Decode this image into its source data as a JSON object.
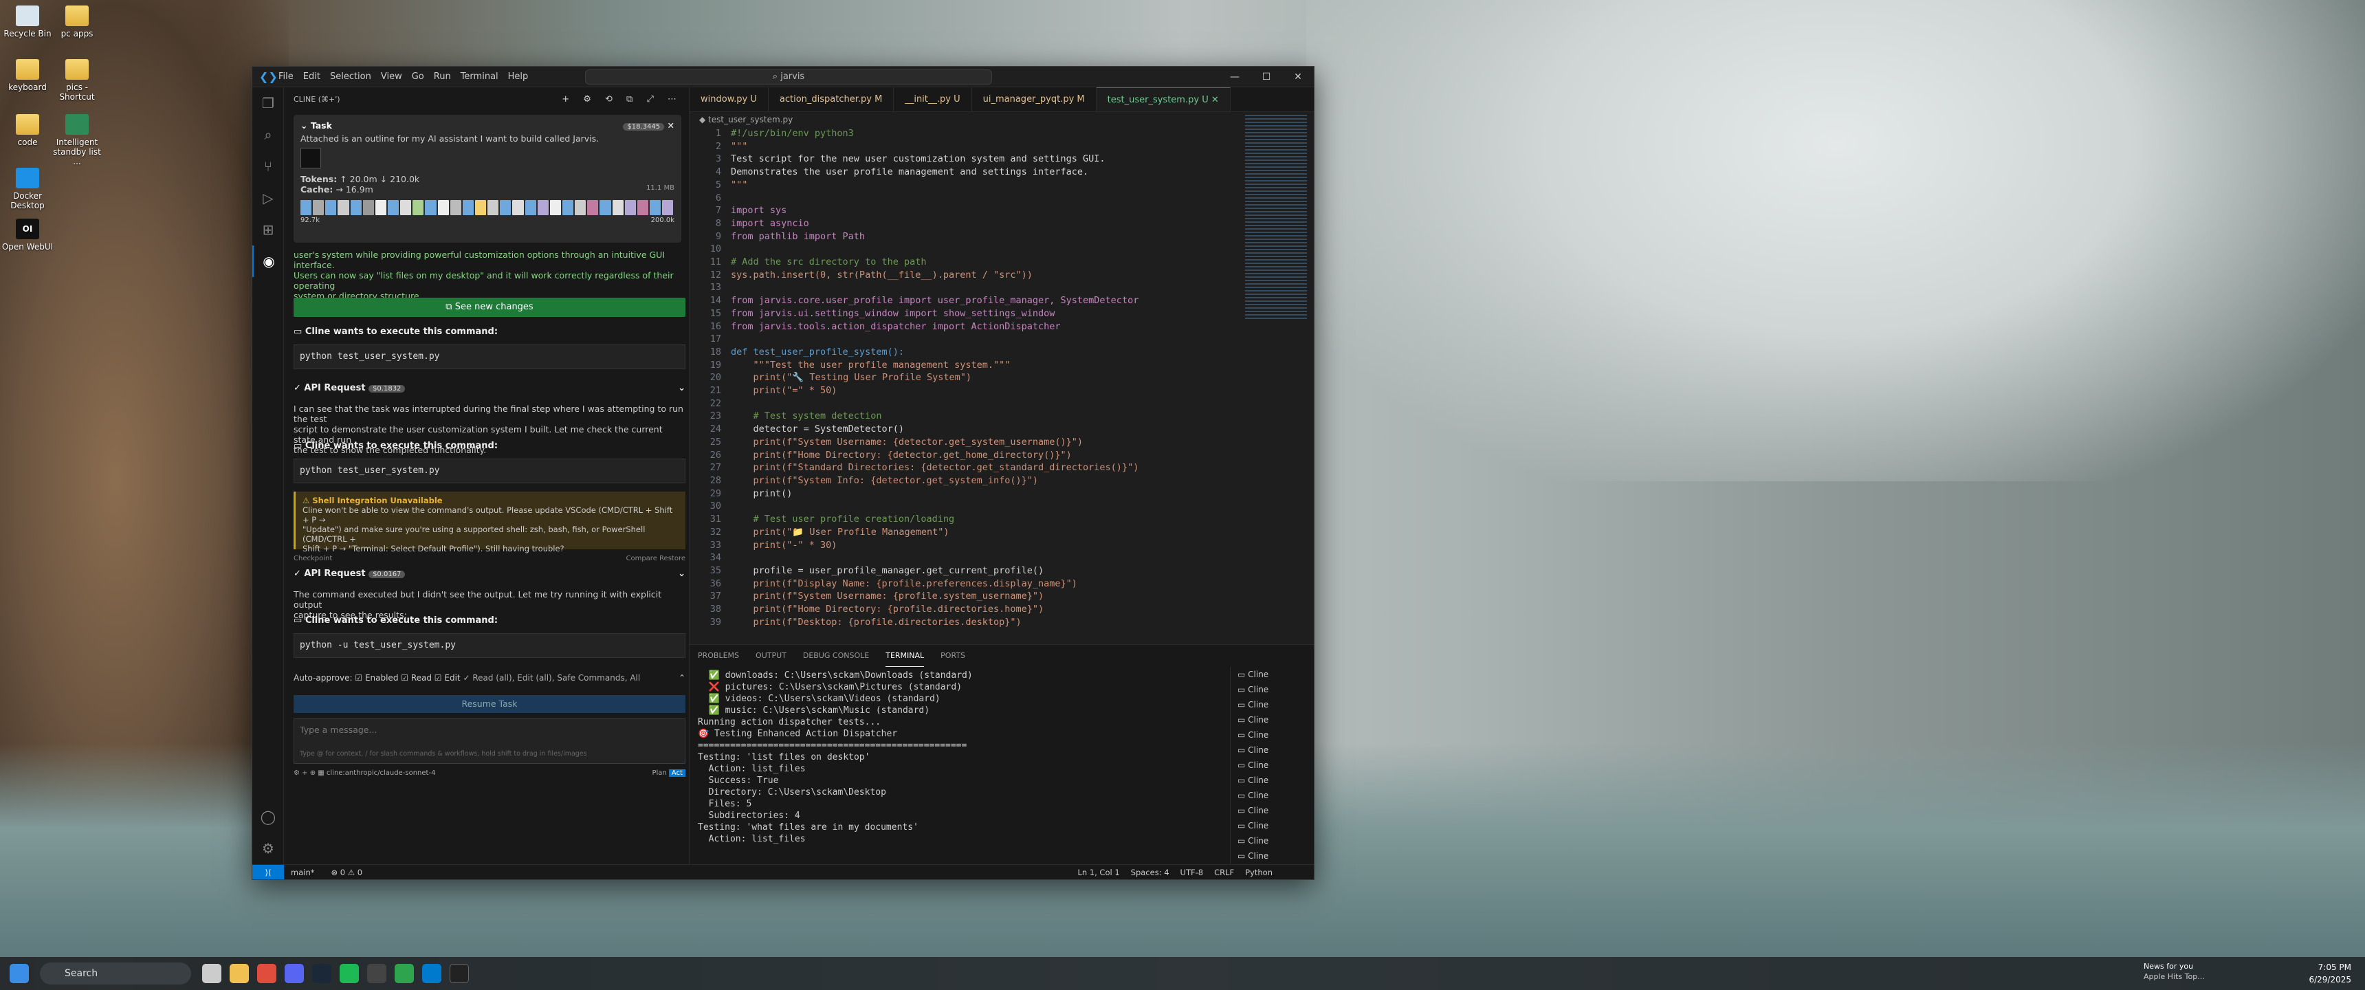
{
  "desktop": {
    "icons": [
      {
        "label": "Recycle Bin",
        "icon": "recycle-bin-icon"
      },
      {
        "label": "pc apps",
        "icon": "folder-icon"
      },
      {
        "label": "keyboard",
        "icon": "folder-icon"
      },
      {
        "label": "pics - Shortcut",
        "icon": "folder-icon"
      },
      {
        "label": "code",
        "icon": "folder-icon"
      },
      {
        "label": "Intelligent standby list ...",
        "icon": "app-icon"
      },
      {
        "label": "Docker Desktop",
        "icon": "docker-icon"
      },
      {
        "label": "Open WebUI",
        "icon": "openwebui-icon"
      }
    ]
  },
  "window": {
    "menu": [
      "File",
      "Edit",
      "Selection",
      "View",
      "Go",
      "Run",
      "Terminal",
      "Help"
    ],
    "search": "jarvis",
    "controls": [
      "—",
      "☐",
      "✕"
    ]
  },
  "cline": {
    "header": "CLINE (⌘+')",
    "task": {
      "title": "Task",
      "cost_badge": "$18.3445",
      "text": "Attached is an outline for my AI assistant I want to build called Jarvis.",
      "tokens_label": "Tokens:",
      "tokens_up": "↑ 20.0m",
      "tokens_down": "↓ 210.0k",
      "cache_label": "Cache:",
      "cache_value": "→ 16.9m",
      "size": "11.1 MB",
      "ctx_used": "92.7k",
      "ctx_max": "200.0k"
    },
    "summary_lines": [
      "user's system while providing powerful customization options through an intuitive GUI interface.",
      "Users can now say \"list files on my desktop\" and it will work correctly regardless of their operating",
      "system or directory structure."
    ],
    "see_changes": "See new changes",
    "cmd_prompt": "Cline wants to execute this command:",
    "cmd1": "python test_user_system.py",
    "api1": {
      "label": "API Request",
      "cost": "$0.1832"
    },
    "api1_text": [
      "I can see that the task was interrupted during the final step where I was attempting to run the test",
      "script to demonstrate the user customization system I built. Let me check the current state and run",
      "the test to show the completed functionality."
    ],
    "cmd2": "python test_user_system.py",
    "warn": {
      "title": "Shell Integration Unavailable",
      "lines": [
        "Cline won't be able to view the command's output. Please update VSCode (CMD/CTRL + Shift + P →",
        "\"Update\") and make sure you're using a supported shell: zsh, bash, fish, or PowerShell (CMD/CTRL +",
        "Shift + P → \"Terminal: Select Default Profile\"). Still having trouble?"
      ]
    },
    "checkpoint": "Checkpoint",
    "compare": "Compare",
    "restore": "Restore",
    "api2": {
      "label": "API Request",
      "cost": "$0.0167"
    },
    "api2_text": [
      "The command executed but I didn't see the output. Let me try running it with explicit output",
      "capture to see the results:"
    ],
    "cmd3": "python -u test_user_system.py",
    "auto": {
      "label": "Auto-approve:",
      "opts": [
        "Enabled",
        "Read",
        "Edit"
      ],
      "summary": "✓ Read (all), Edit (all), Safe Commands, All"
    },
    "resume": "Resume Task",
    "input_placeholder": "Type a message...",
    "input_hint": "Type @ for context, / for slash commands & workflows, hold shift to drag in files/images",
    "model": "cline:anthropic/claude-sonnet-4",
    "plan": "Plan",
    "act": "Act"
  },
  "editor": {
    "tabs": [
      {
        "label": "window.py",
        "tag": "U"
      },
      {
        "label": "action_dispatcher.py",
        "tag": "M"
      },
      {
        "label": "__init__.py",
        "tag": "U"
      },
      {
        "label": "ui_manager_pyqt.py",
        "tag": "M"
      },
      {
        "label": "test_user_system.py",
        "tag": "U"
      }
    ],
    "breadcrumb": "test_user_system.py",
    "lines": [
      "#!/usr/bin/env python3",
      "\"\"\"",
      "Test script for the new user customization system and settings GUI.",
      "Demonstrates the user profile management and settings interface.",
      "\"\"\"",
      "",
      "import sys",
      "import asyncio",
      "from pathlib import Path",
      "",
      "# Add the src directory to the path",
      "sys.path.insert(0, str(Path(__file__).parent / \"src\"))",
      "",
      "from jarvis.core.user_profile import user_profile_manager, SystemDetector",
      "from jarvis.ui.settings_window import show_settings_window",
      "from jarvis.tools.action_dispatcher import ActionDispatcher",
      "",
      "def test_user_profile_system():",
      "    \"\"\"Test the user profile management system.\"\"\"",
      "    print(\"🔧 Testing User Profile System\")",
      "    print(\"=\" * 50)",
      "",
      "    # Test system detection",
      "    detector = SystemDetector()",
      "    print(f\"System Username: {detector.get_system_username()}\")",
      "    print(f\"Home Directory: {detector.get_home_directory()}\")",
      "    print(f\"Standard Directories: {detector.get_standard_directories()}\")",
      "    print(f\"System Info: {detector.get_system_info()}\")",
      "    print()",
      "",
      "    # Test user profile creation/loading",
      "    print(\"📁 User Profile Management\")",
      "    print(\"-\" * 30)",
      "",
      "    profile = user_profile_manager.get_current_profile()",
      "    print(f\"Display Name: {profile.preferences.display_name}\")",
      "    print(f\"System Username: {profile.system_username}\")",
      "    print(f\"Home Directory: {profile.directories.home}\")",
      "    print(f\"Desktop: {profile.directories.desktop}\")"
    ]
  },
  "panel": {
    "tabs": [
      "PROBLEMS",
      "OUTPUT",
      "DEBUG CONSOLE",
      "TERMINAL",
      "PORTS"
    ],
    "terminal": [
      "  ✅ downloads: C:\\Users\\sckam\\Downloads (standard)",
      "  ❌ pictures: C:\\Users\\sckam\\Pictures (standard)",
      "  ✅ videos: C:\\Users\\sckam\\Videos (standard)",
      "  ✅ music: C:\\Users\\sckam\\Music (standard)",
      "",
      "Running action dispatcher tests...",
      "🎯 Testing Enhanced Action Dispatcher",
      "==================================================",
      "Testing: 'list files on desktop'",
      "  Action: list_files",
      "  Success: True",
      "  Directory: C:\\Users\\sckam\\Desktop",
      "  Files: 5",
      "  Subdirectories: 4",
      "",
      "Testing: 'what files are in my documents'",
      "  Action: list_files"
    ],
    "instances": [
      "Cline",
      "Cline",
      "Cline",
      "Cline",
      "Cline",
      "Cline",
      "Cline",
      "Cline",
      "Cline",
      "Cline",
      "Cline",
      "Cline",
      "Cline",
      "Cline"
    ]
  },
  "status": {
    "branch": "main*",
    "errors": "⊗ 0 ⚠ 0",
    "pos": "Ln 1, Col 1",
    "spaces": "Spaces: 4",
    "enc": "UTF-8",
    "eol": "CRLF",
    "lang": "Python"
  },
  "taskbar": {
    "search": "Search",
    "news_title": "News for you",
    "news_sub": "Apple Hits Top...",
    "time": "7:05 PM",
    "date": "6/29/2025"
  }
}
